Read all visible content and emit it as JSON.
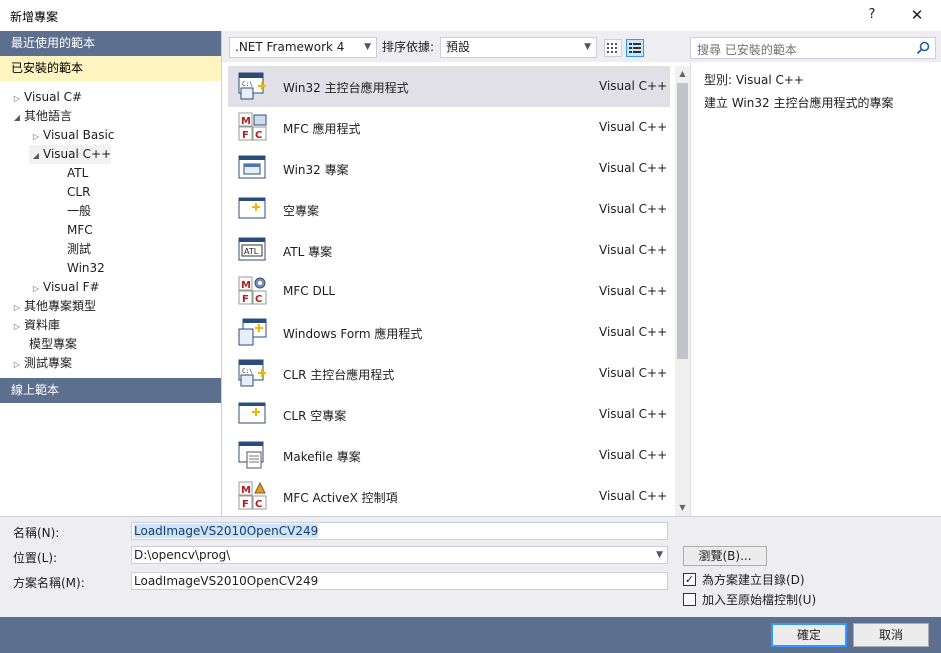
{
  "window": {
    "title": "新增專案",
    "help_glyph": "?",
    "close_glyph": "✕"
  },
  "left_panel": {
    "recent_header": "最近使用的範本",
    "installed_header": "已安裝的範本",
    "online_header": "線上範本",
    "tree": [
      {
        "label": "Visual C#",
        "arrow": "▷"
      },
      {
        "label": "其他語言",
        "arrow": "◢"
      },
      {
        "label": "Visual Basic",
        "arrow": "▷"
      },
      {
        "label": "Visual C++",
        "arrow": "◢"
      },
      {
        "label": "ATL",
        "arrow": ""
      },
      {
        "label": "CLR",
        "arrow": ""
      },
      {
        "label": "一般",
        "arrow": ""
      },
      {
        "label": "MFC",
        "arrow": ""
      },
      {
        "label": "測試",
        "arrow": ""
      },
      {
        "label": "Win32",
        "arrow": ""
      },
      {
        "label": "Visual F#",
        "arrow": "▷"
      },
      {
        "label": "其他專案類型",
        "arrow": "▷"
      },
      {
        "label": "資料庫",
        "arrow": "▷"
      },
      {
        "label": "模型專案",
        "arrow": ""
      },
      {
        "label": "測試專案",
        "arrow": "▷"
      }
    ]
  },
  "toolbar": {
    "framework": ".NET Framework 4",
    "sort_label": "排序依據:",
    "sort_value": "預設",
    "search_placeholder": "搜尋 已安裝的範本"
  },
  "templates": [
    {
      "name": "Win32 主控台應用程式",
      "lang": "Visual C++",
      "icon": "console-app-icon"
    },
    {
      "name": "MFC 應用程式",
      "lang": "Visual C++",
      "icon": "mfc-app-icon"
    },
    {
      "name": "Win32 專案",
      "lang": "Visual C++",
      "icon": "win32-project-icon"
    },
    {
      "name": "空專案",
      "lang": "Visual C++",
      "icon": "empty-project-icon"
    },
    {
      "name": "ATL 專案",
      "lang": "Visual C++",
      "icon": "atl-project-icon"
    },
    {
      "name": "MFC DLL",
      "lang": "Visual C++",
      "icon": "mfc-dll-icon"
    },
    {
      "name": "Windows Form 應用程式",
      "lang": "Visual C++",
      "icon": "windows-form-icon"
    },
    {
      "name": "CLR 主控台應用程式",
      "lang": "Visual C++",
      "icon": "clr-console-icon"
    },
    {
      "name": "CLR 空專案",
      "lang": "Visual C++",
      "icon": "clr-empty-icon"
    },
    {
      "name": "Makefile 專案",
      "lang": "Visual C++",
      "icon": "makefile-icon"
    },
    {
      "name": "MFC ActiveX 控制項",
      "lang": "Visual C++",
      "icon": "mfc-activex-icon"
    }
  ],
  "description": {
    "type_line": "型別:  Visual C++",
    "text": "建立 Win32 主控台應用程式的專案"
  },
  "form": {
    "name_label": "名稱(N):",
    "name_value": "LoadImageVS2010OpenCV249",
    "location_label": "位置(L):",
    "location_value": "D:\\opencv\\prog\\",
    "solution_label": "方案名稱(M):",
    "solution_value": "LoadImageVS2010OpenCV249",
    "browse_label": "瀏覽(B)...",
    "create_dir_label": "為方案建立目錄(D)",
    "create_dir_checked": true,
    "add_source_label": "加入至原始檔控制(U)",
    "add_source_checked": false
  },
  "buttons": {
    "ok": "確定",
    "cancel": "取消"
  },
  "colors": {
    "header_bg": "#5d6f8f",
    "selected_bg": "#fdf4bf",
    "accent": "#3399ff"
  }
}
